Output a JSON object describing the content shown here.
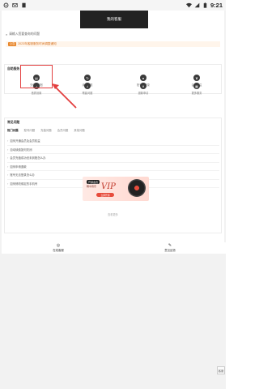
{
  "status_bar": {
    "time": "9:21",
    "left_icons": [
      "gear-icon",
      "mail-icon",
      "sim-icon"
    ],
    "right_icons": [
      "wifi-icon",
      "signal-icon",
      "battery-icon"
    ]
  },
  "header": {
    "dialog_title": "我的客服",
    "back_label": "<"
  },
  "info": {
    "line": "请输入您要查询的问题"
  },
  "notice": {
    "badge": "公告",
    "text": "2023年客服服务时间调整通知"
  },
  "services": {
    "title": "自助服务",
    "items": [
      {
        "label": "充值未到账",
        "icon": "wallet-icon"
      },
      {
        "label": "续费问题",
        "icon": "refresh-icon"
      },
      {
        "label": "账号与登录",
        "icon": "user-icon"
      },
      {
        "label": "会员权益",
        "icon": "crown-icon"
      },
      {
        "label": "音质设置",
        "icon": "music-icon"
      },
      {
        "label": "歌曲问题",
        "icon": "song-icon"
      },
      {
        "label": "退款申请",
        "icon": "money-icon"
      },
      {
        "label": "更多服务",
        "icon": "grid-icon"
      }
    ]
  },
  "faq": {
    "title": "常见问题",
    "tabs": [
      "热门问题",
      "账号问题",
      "充值问题",
      "会员问题",
      "其他问题"
    ],
    "items": [
      "如何开通会员及会员权益",
      "自动续费如何关闭",
      "会员充值成功但未到账怎么办",
      "如何申请退款",
      "账号无法登录怎么办",
      "如何修改绑定的手机号"
    ],
    "more": "查看更多"
  },
  "banner": {
    "pill": "开通会员",
    "sub": "畅享音乐",
    "vip": "VIP",
    "button": "立即开通"
  },
  "bottom": {
    "left_label": "在线客服",
    "right_label": "意见反馈"
  },
  "side_handle": "客服"
}
